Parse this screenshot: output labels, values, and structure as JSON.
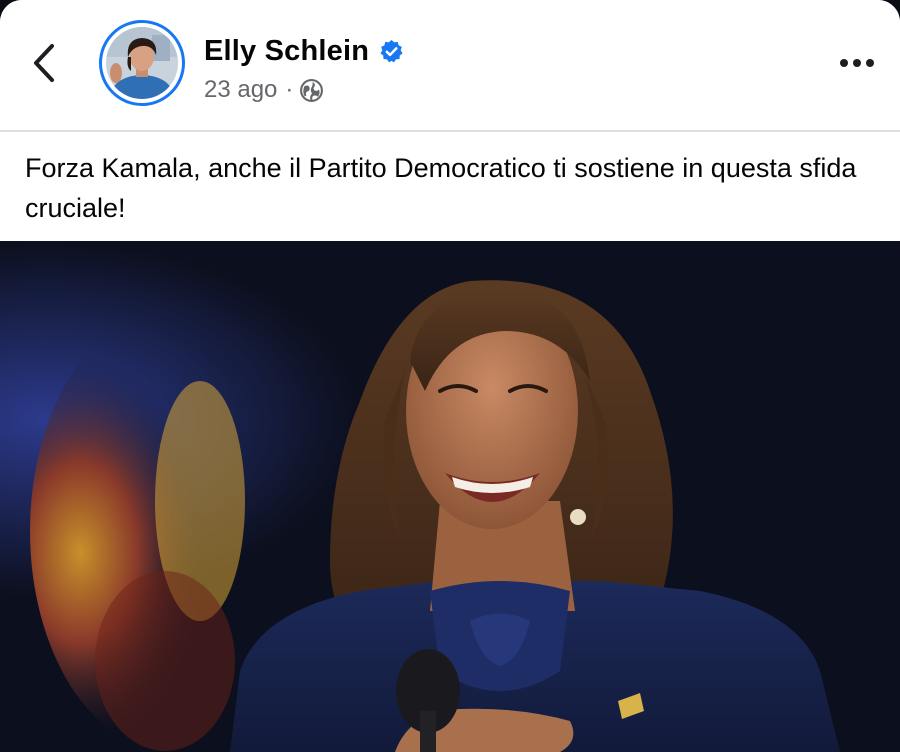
{
  "post": {
    "author": {
      "name": "Elly Schlein",
      "verified": true
    },
    "meta": {
      "date": "23 ago",
      "separator": "·",
      "audience_icon": "globe-icon"
    },
    "text": "Forza Kamala, anche il Partito Democratico ti sostiene in questa sfida cruciale!"
  },
  "icons": {
    "back": "chevron-left-icon",
    "more": "more-horizontal-icon",
    "verified": "verified-badge-icon",
    "audience": "globe-icon"
  },
  "colors": {
    "accent": "#1877f2",
    "text_primary": "#050505",
    "text_secondary": "#65676b",
    "divider": "#dcdfe3"
  }
}
